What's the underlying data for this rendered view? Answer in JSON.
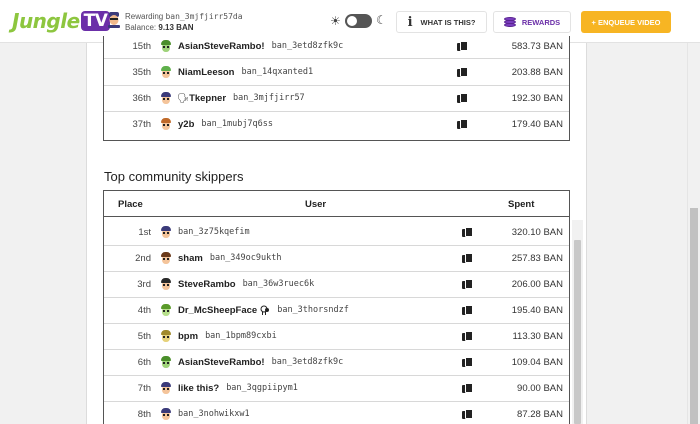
{
  "header": {
    "logo_main": "Jungle",
    "logo_tv": "TV",
    "rewarding_label": "Rewarding",
    "rewarding_address": "ban_3mjfjirr57da",
    "balance_label": "Balance:",
    "balance_value": "9.13 BAN",
    "what_is_this_label": "WHAT IS THIS?",
    "rewards_label": "REWARDS",
    "enqueue_label": "+ ENQUEUE VIDEO"
  },
  "top_table": {
    "rows": [
      {
        "place": "15th",
        "name": "AsianSteveRambo!",
        "address": "ban_3etd8zfk9c",
        "amount": "583.73 BAN"
      },
      {
        "place": "35th",
        "name": "NiamLeeson",
        "address": "ban_14qxanted1",
        "amount": "203.88 BAN"
      },
      {
        "place": "36th",
        "name": "Tkepner",
        "address": "ban_3mjfjirr57",
        "amount": "192.30 BAN"
      },
      {
        "place": "37th",
        "name": "y2b",
        "address": "ban_1mubj7q6ss",
        "amount": "179.40 BAN"
      }
    ]
  },
  "skippers": {
    "title": "Top community skippers",
    "col_place": "Place",
    "col_user": "User",
    "col_spent": "Spent",
    "rows": [
      {
        "place": "1st",
        "name": "",
        "address": "ban_3z75kqefim",
        "amount": "320.10 BAN"
      },
      {
        "place": "2nd",
        "name": "sham",
        "address": "ban_349oc9ukth",
        "amount": "257.83 BAN"
      },
      {
        "place": "3rd",
        "name": "SteveRambo",
        "address": "ban_36w3ruec6k",
        "amount": "206.00 BAN"
      },
      {
        "place": "4th",
        "name": "Dr_McSheepFace",
        "address": "ban_3thorsndzf",
        "amount": "195.40 BAN"
      },
      {
        "place": "5th",
        "name": "bpm",
        "address": "ban_1bpm89cxbi",
        "amount": "113.30 BAN"
      },
      {
        "place": "6th",
        "name": "AsianSteveRambo!",
        "address": "ban_3etd8zfk9c",
        "amount": "109.04 BAN"
      },
      {
        "place": "7th",
        "name": "like this?",
        "address": "ban_3qgpiipym1",
        "amount": "90.00 BAN"
      },
      {
        "place": "8th",
        "name": "",
        "address": "ban_3nohwikxw1",
        "amount": "87.28 BAN"
      }
    ]
  },
  "colors": {
    "accent_yellow": "#f7b523",
    "brand_purple": "#6b2fa8",
    "brand_green": "#8dc63f"
  }
}
